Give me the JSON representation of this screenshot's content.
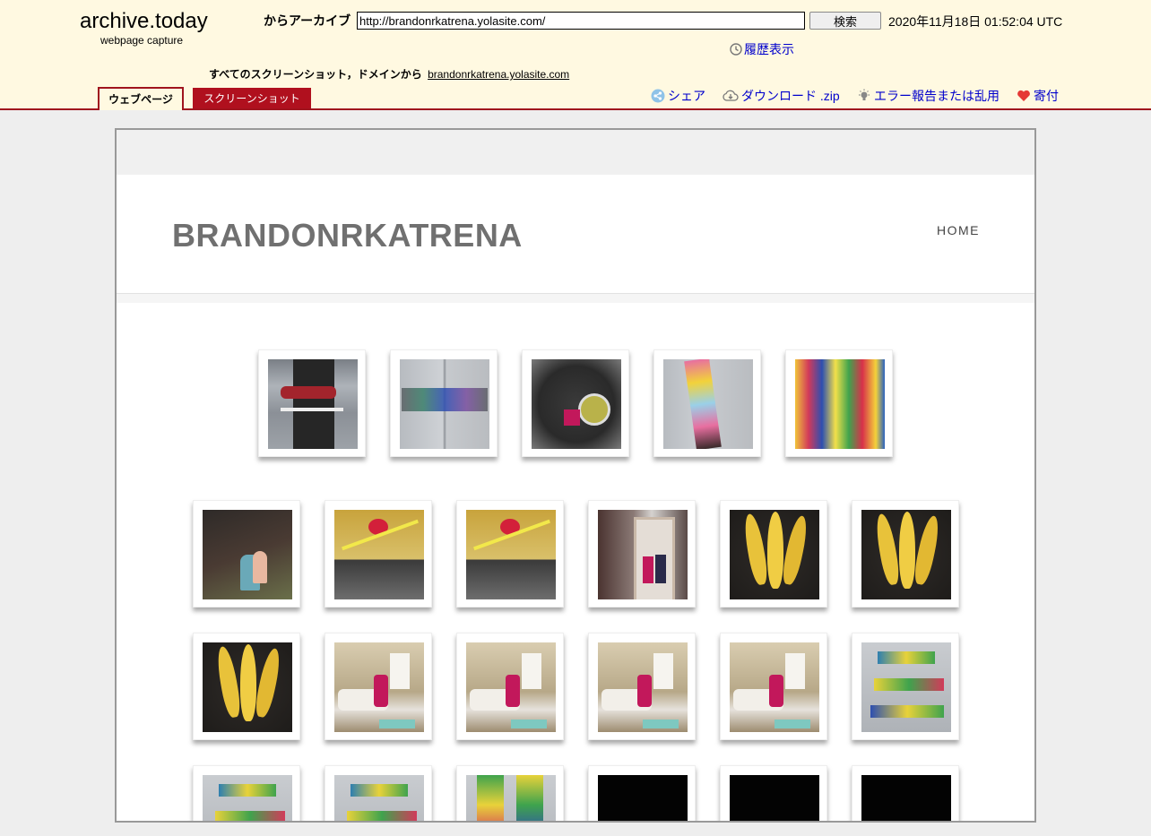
{
  "archive": {
    "logo": "archive.today",
    "logo_sub": "webpage capture",
    "archive_label": "からアーカイブ",
    "url_value": "http://brandonrkatrena.yolasite.com/",
    "search_button": "検索",
    "capture_date": "2020年11月18日 01:52:04 UTC",
    "history_link": "履歴表示",
    "all_screenshots_label": "すべてのスクリーンショット，ドメインから",
    "domain_link": "brandonrkatrena.yolasite.com",
    "tabs": {
      "webpage": "ウェブページ",
      "screenshot": "スクリーンショット"
    },
    "actions": {
      "share": "シェア",
      "download": "ダウンロード .zip",
      "report": "エラー報告または乱用",
      "donate": "寄付"
    },
    "colors": {
      "header_bg": "#fff9e1",
      "accent": "#a0141e",
      "link": "#0000cc"
    }
  },
  "site": {
    "title": "BRANDONRKATRENA",
    "nav": [
      "HOME"
    ]
  },
  "gallery": {
    "rows": [
      [
        "wood-jewel",
        "art-letters",
        "dark-cup",
        "painted-stick",
        "painted-canvas"
      ],
      [
        "kids-in-room",
        "ribbon-collage",
        "ribbon-collage",
        "framed-photo",
        "bananas",
        "bananas"
      ],
      [
        "bananas",
        "woman-on-sofa",
        "woman-on-sofa",
        "woman-on-sofa",
        "woman-on-sofa",
        "painted-blocks"
      ],
      [
        "painted-blocks",
        "painted-blocks",
        "painted-sticks",
        "black",
        "black",
        "black"
      ]
    ]
  }
}
